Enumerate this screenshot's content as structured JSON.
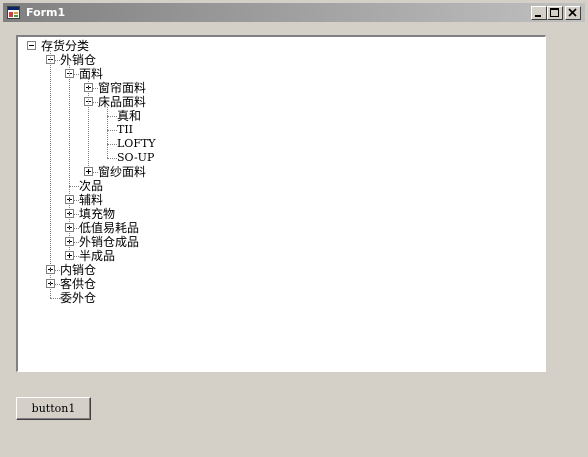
{
  "window": {
    "title": "Form1"
  },
  "tree": {
    "nodes": [
      {
        "label": "存货分类",
        "level": 0,
        "expander": "minus"
      },
      {
        "label": "外销仓",
        "level": 1,
        "expander": "minus"
      },
      {
        "label": "面料",
        "level": 2,
        "expander": "minus"
      },
      {
        "label": "窗帘面料",
        "level": 3,
        "expander": "plus"
      },
      {
        "label": "床品面料",
        "level": 3,
        "expander": "minus"
      },
      {
        "label": "真和",
        "level": 4,
        "expander": "none"
      },
      {
        "label": "TII",
        "level": 4,
        "expander": "none"
      },
      {
        "label": "LOFTY",
        "level": 4,
        "expander": "none"
      },
      {
        "label": "SO-UP",
        "level": 4,
        "expander": "none"
      },
      {
        "label": "窗纱面料",
        "level": 3,
        "expander": "plus"
      },
      {
        "label": "次品",
        "level": 2,
        "expander": "none"
      },
      {
        "label": "辅料",
        "level": 2,
        "expander": "plus"
      },
      {
        "label": "填充物",
        "level": 2,
        "expander": "plus"
      },
      {
        "label": "低值易耗品",
        "level": 2,
        "expander": "plus"
      },
      {
        "label": "外销仓成品",
        "level": 2,
        "expander": "plus"
      },
      {
        "label": "半成品",
        "level": 2,
        "expander": "plus"
      },
      {
        "label": "内销仓",
        "level": 1,
        "expander": "plus"
      },
      {
        "label": "客供仓",
        "level": 1,
        "expander": "plus"
      },
      {
        "label": "委外仓",
        "level": 1,
        "expander": "none"
      }
    ]
  },
  "button1": {
    "label": "button1"
  },
  "colors": {
    "face": "#d4d0c8",
    "title_gradient_start": "#808080",
    "title_gradient_end": "#c0c0c0",
    "tree_background": "#ffffff"
  }
}
